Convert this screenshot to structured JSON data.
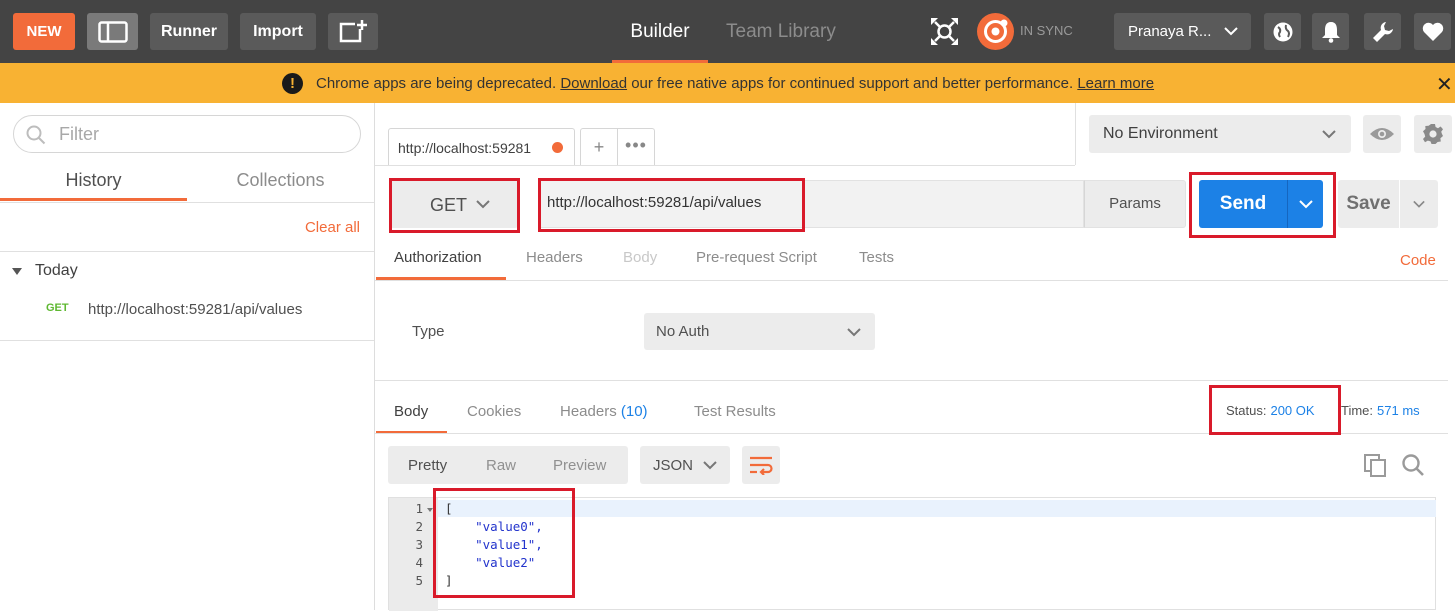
{
  "topbar": {
    "new_label": "NEW",
    "runner_label": "Runner",
    "import_label": "Import",
    "tabs": {
      "builder": "Builder",
      "team_library": "Team Library"
    },
    "sync_status": "IN SYNC",
    "user_name": "Pranaya R...",
    "accent_color": "#f26b3a"
  },
  "banner": {
    "text_before": "Chrome apps are being deprecated. ",
    "download_link": "Download",
    "text_after": " our free native apps for continued support and better performance. ",
    "learn_more_link": "Learn more",
    "close_glyph": "✕",
    "warn_glyph": "!"
  },
  "sidebar": {
    "filter_placeholder": "Filter",
    "tabs": [
      "History",
      "Collections"
    ],
    "clear_all": "Clear all",
    "group_label": "Today",
    "history": [
      {
        "method": "GET",
        "url": "http://localhost:59281/api/values"
      }
    ]
  },
  "request": {
    "tab_title": "http://localhost:59281",
    "add_tab_glyph": "+",
    "more_tabs_glyph": "•••",
    "environment": "No Environment",
    "method": "GET",
    "url": "http://localhost:59281/api/values",
    "params_label": "Params",
    "send_label": "Send",
    "save_label": "Save",
    "tabs": [
      "Authorization",
      "Headers",
      "Body",
      "Pre-request Script",
      "Tests"
    ],
    "code_link": "Code",
    "auth_type_label": "Type",
    "auth_type_value": "No Auth"
  },
  "response": {
    "tabs": [
      "Body",
      "Cookies",
      "Headers",
      "Test Results"
    ],
    "headers_count": "(10)",
    "status_label": "Status:",
    "status_value": "200 OK",
    "time_label": "Time:",
    "time_value": "571 ms",
    "views": [
      "Pretty",
      "Raw",
      "Preview"
    ],
    "format": "JSON",
    "body_lines": [
      {
        "num": "1",
        "text": "["
      },
      {
        "num": "2",
        "text": "    \"value0\","
      },
      {
        "num": "3",
        "text": "    \"value1\","
      },
      {
        "num": "4",
        "text": "    \"value2\""
      },
      {
        "num": "5",
        "text": "]"
      }
    ],
    "status_color": "#1c81e6"
  },
  "annotation_color": "#d91a2a"
}
